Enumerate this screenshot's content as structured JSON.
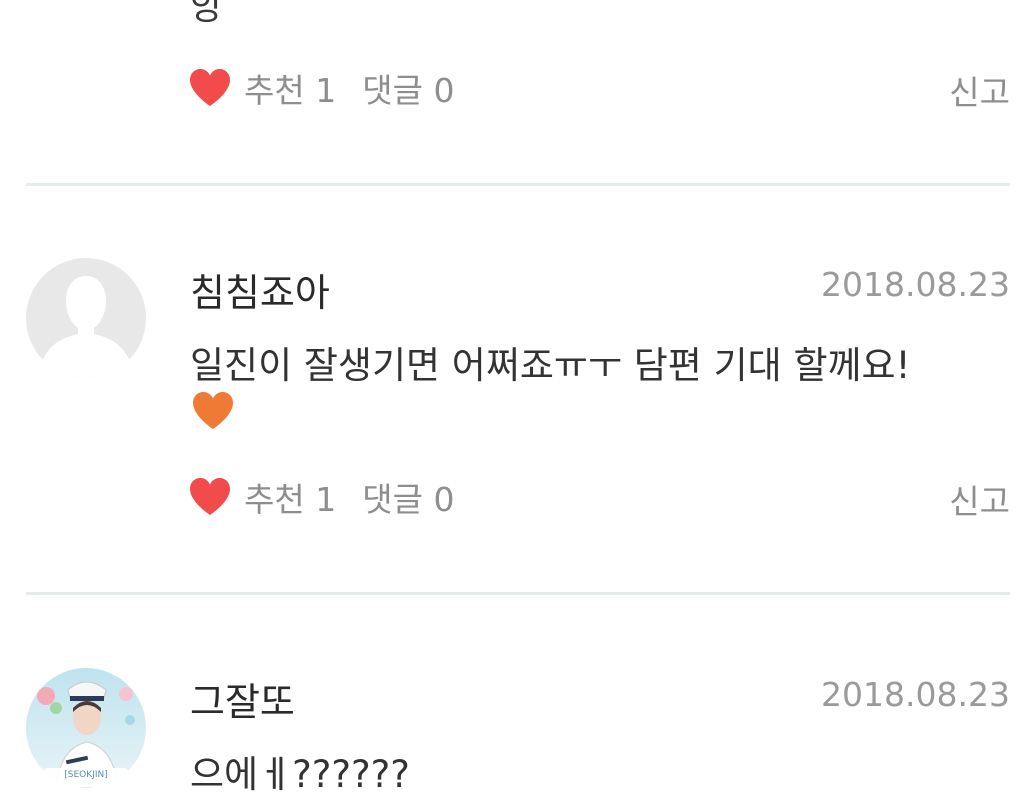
{
  "previous_comment": {
    "text_fragment": "앙",
    "recommend_label": "추천",
    "recommend_count": "1",
    "reply_label": "댓글",
    "reply_count": "0",
    "report_label": "신고"
  },
  "comments": [
    {
      "username": "침침죠아",
      "date": "2018.08.23",
      "body": "일진이 잘생기면 어쩌죠ㅠㅜ 담편 기대 할께요!",
      "emoji": "orange-heart",
      "recommend_label": "추천",
      "recommend_count": "1",
      "reply_label": "댓글",
      "reply_count": "0",
      "report_label": "신고",
      "avatar": "default-avatar"
    },
    {
      "username": "그잘또",
      "date": "2018.08.23",
      "body": "으에ㅔ??????",
      "avatar": "photo-avatar",
      "avatar_caption": "[SEOKJIN]"
    }
  ],
  "colors": {
    "like_heart": "#f24b4b",
    "emoji_heart": "#ef7a35",
    "divider": "#e6ecec",
    "muted_text": "#8e8e8e"
  }
}
